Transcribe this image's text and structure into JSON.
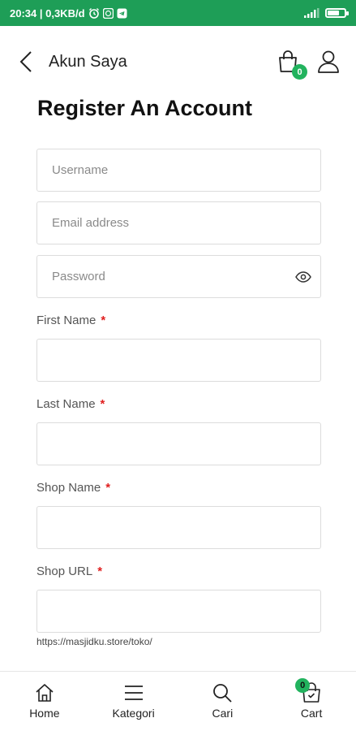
{
  "status_bar": {
    "time_speed": "20:34 | 0,3KB/d",
    "icons": [
      "alarm-icon",
      "whatsapp-icon",
      "telegram-icon"
    ],
    "right_icons": [
      "signal-icon",
      "battery-icon"
    ],
    "battery_level": 0.65,
    "color": "#1e9e57"
  },
  "header": {
    "title": "Akun Saya",
    "cart_count": "0"
  },
  "form": {
    "title": "Register An Account",
    "username_placeholder": "Username",
    "email_placeholder": "Email address",
    "password_placeholder": "Password",
    "first_name_label": "First Name",
    "last_name_label": "Last Name",
    "shop_name_label": "Shop Name",
    "shop_url_label": "Shop URL",
    "required_mark": "*",
    "shop_url_hint": "https://masjidku.store/toko/"
  },
  "bottom_nav": {
    "items": [
      {
        "label": "Home",
        "icon": "home-icon"
      },
      {
        "label": "Kategori",
        "icon": "menu-icon"
      },
      {
        "label": "Cari",
        "icon": "search-icon"
      },
      {
        "label": "Cart",
        "icon": "cart-icon"
      }
    ],
    "cart_count": "0"
  },
  "colors": {
    "accent": "#22b35e",
    "required": "#e02020"
  }
}
